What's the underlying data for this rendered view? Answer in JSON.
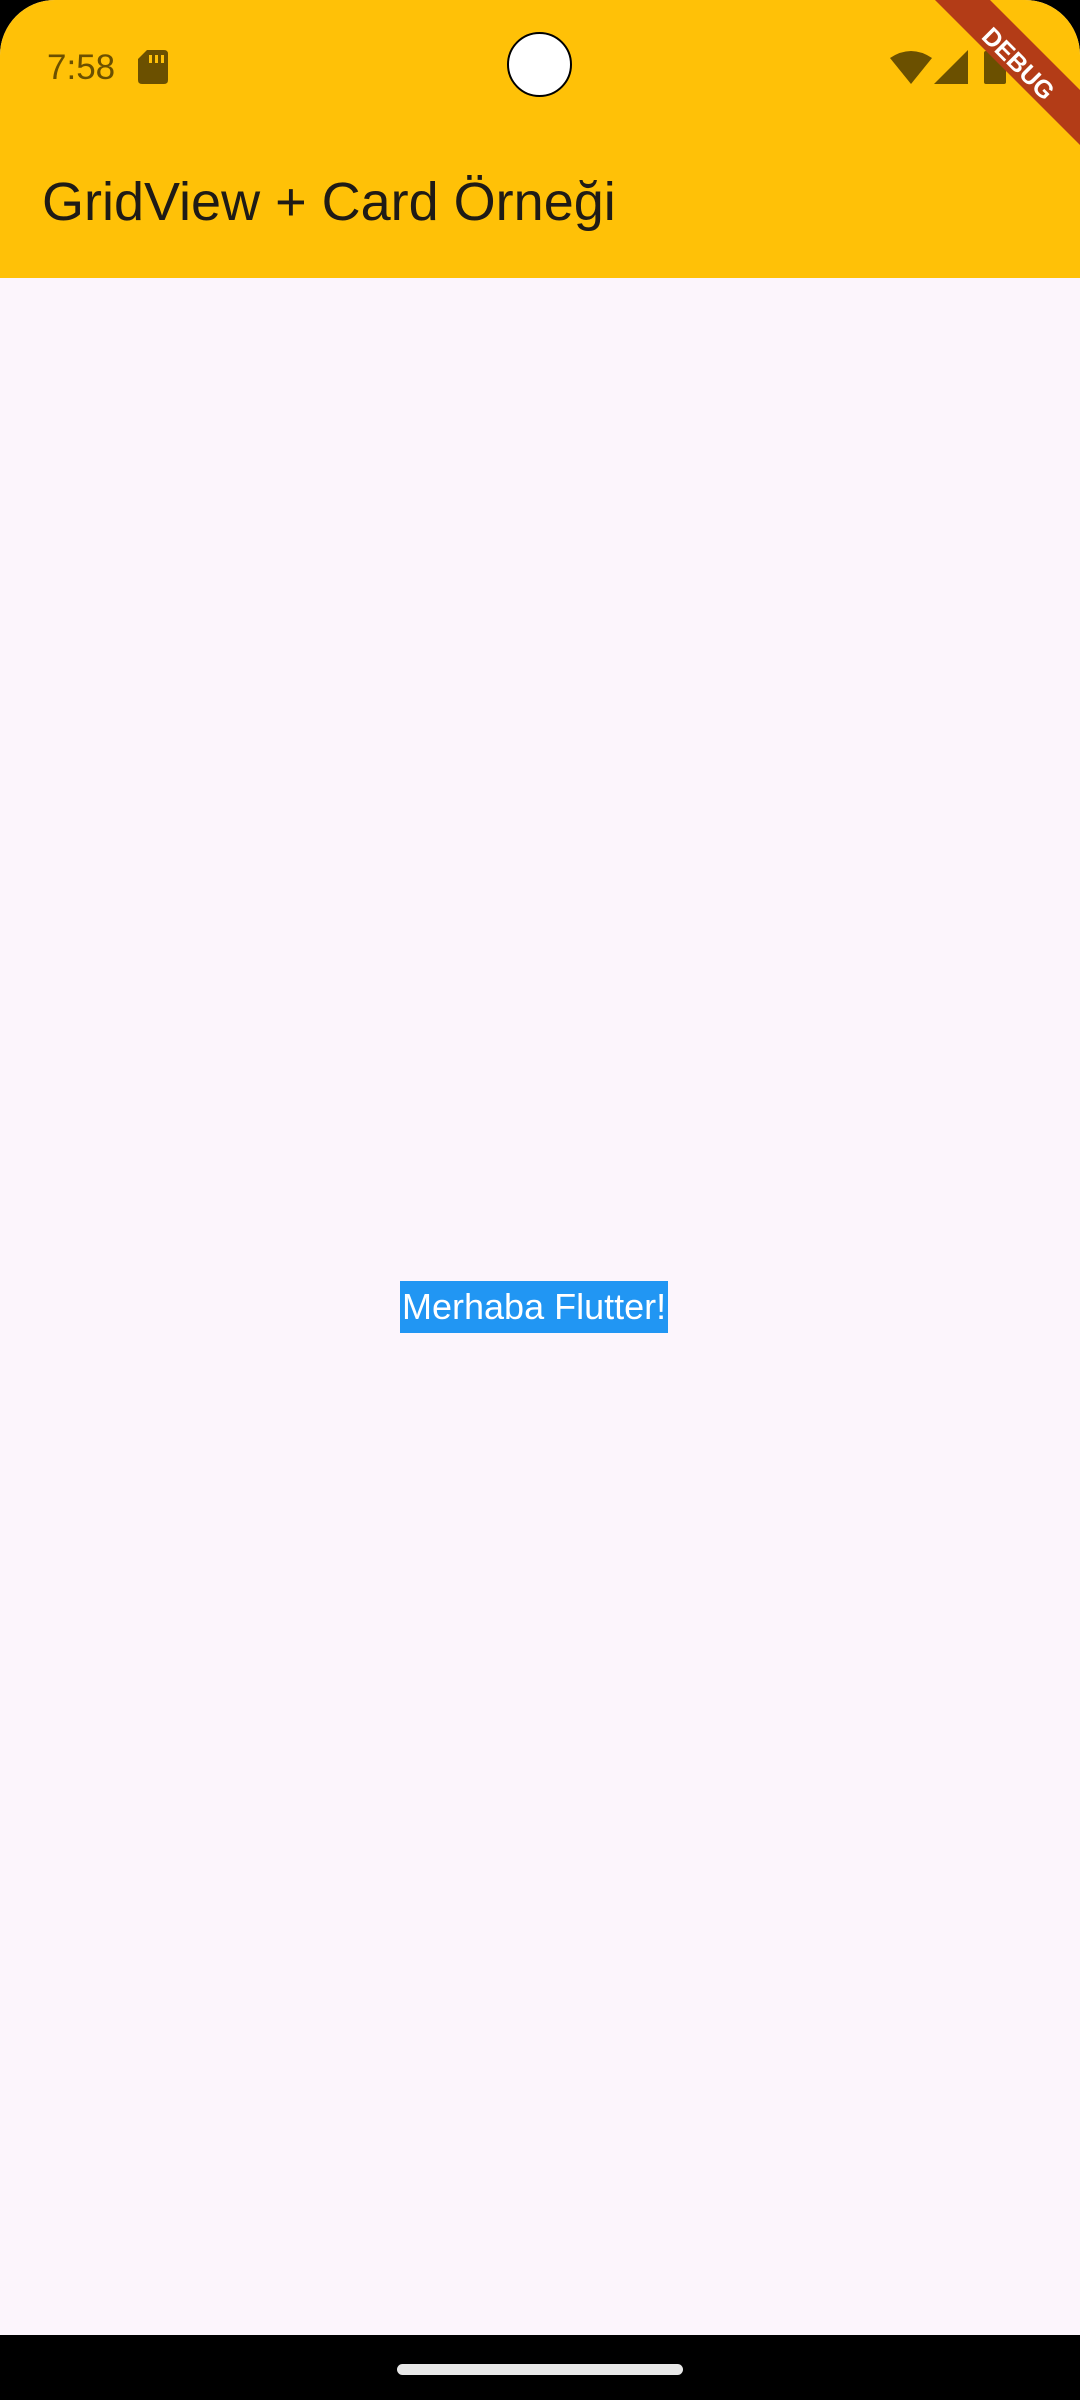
{
  "status_bar": {
    "time": "7:58",
    "icons": [
      "sd-card-icon",
      "camera-cutout",
      "wifi-icon",
      "signal-icon",
      "battery-icon"
    ]
  },
  "app_bar": {
    "title": "GridView + Card Örneği",
    "background_color": "#FFC107"
  },
  "debug_banner": {
    "label": "DEBUG",
    "color": "#B33C17"
  },
  "body": {
    "background_color": "#FCF5FC",
    "text": "Merhaba Flutter!",
    "text_background_color": "#2196F3",
    "text_color": "#FFFFFF"
  },
  "navigation": {
    "icons": [
      "home-gesture-handle"
    ]
  }
}
